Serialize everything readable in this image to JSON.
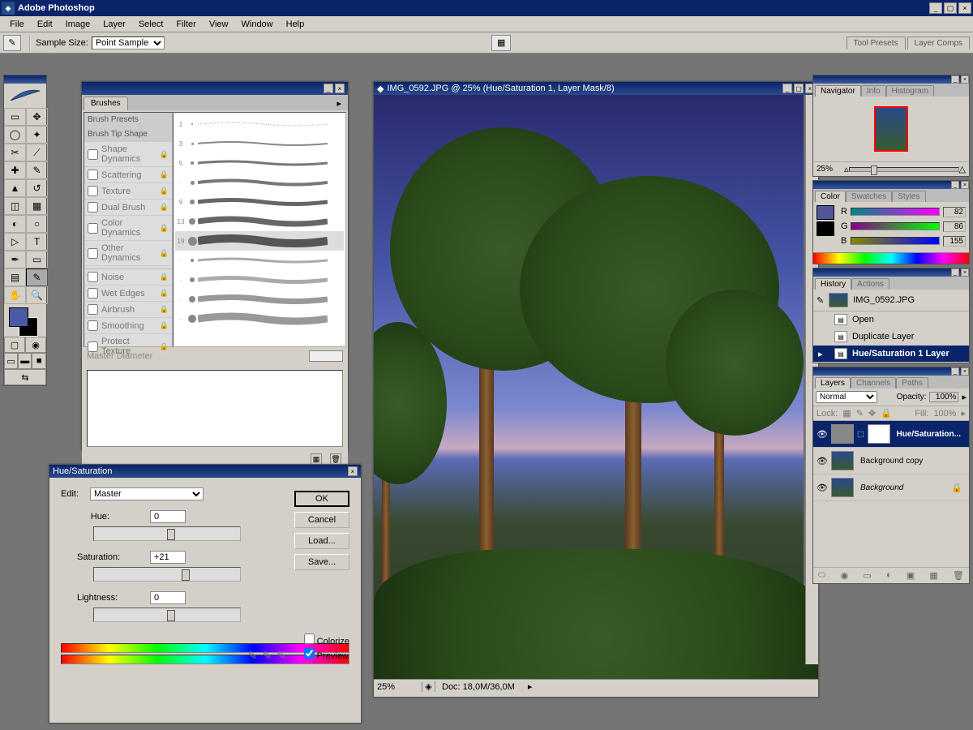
{
  "app": {
    "title": "Adobe Photoshop"
  },
  "menu": [
    "File",
    "Edit",
    "Image",
    "Layer",
    "Select",
    "Filter",
    "View",
    "Window",
    "Help"
  ],
  "options": {
    "sampleLabel": "Sample Size:",
    "sampleValue": "Point Sample",
    "dockTabs": [
      "Tool Presets",
      "Layer Comps"
    ]
  },
  "brushes": {
    "title": "Brushes",
    "categories": [
      "Brush Presets",
      "Brush Tip Shape",
      "Shape Dynamics",
      "Scattering",
      "Texture",
      "Dual Brush",
      "Color Dynamics",
      "Other Dynamics"
    ],
    "extras": [
      "Noise",
      "Wet Edges",
      "Airbrush",
      "Smoothing",
      "Protect Texture"
    ],
    "sizes": [
      1,
      3,
      5,
      "·",
      "·",
      "9",
      "13",
      "19",
      "·",
      "·",
      "·",
      "·"
    ],
    "master": "Master Diameter"
  },
  "doc": {
    "title": "IMG_0592.JPG @ 25% (Hue/Saturation 1, Layer Mask/8)",
    "zoom": "25%",
    "info": "Doc: 18,0M/36,0M"
  },
  "hueSat": {
    "title": "Hue/Saturation",
    "editLabel": "Edit:",
    "editValue": "Master",
    "hueLabel": "Hue:",
    "hueValue": "0",
    "satLabel": "Saturation:",
    "satValue": "+21",
    "lightLabel": "Lightness:",
    "lightValue": "0",
    "ok": "OK",
    "cancel": "Cancel",
    "load": "Load...",
    "save": "Save...",
    "colorize": "Colorize",
    "preview": "Preview"
  },
  "navigator": {
    "tabs": [
      "Navigator",
      "Info",
      "Histogram"
    ],
    "zoom": "25%"
  },
  "color": {
    "tabs": [
      "Color",
      "Swatches",
      "Styles"
    ],
    "r": "82",
    "g": "86",
    "b": "155"
  },
  "history": {
    "tabs": [
      "History",
      "Actions"
    ],
    "doc": "IMG_0592.JPG",
    "items": [
      "Open",
      "Duplicate Layer",
      "Hue/Saturation 1 Layer"
    ]
  },
  "layers": {
    "tabs": [
      "Layers",
      "Channels",
      "Paths"
    ],
    "blend": "Normal",
    "opacityLabel": "Opacity:",
    "opacity": "100%",
    "lockLabel": "Lock:",
    "fillLabel": "Fill:",
    "fill": "100%",
    "items": [
      {
        "name": "Hue/Saturation...",
        "active": true,
        "mask": true
      },
      {
        "name": "Background copy"
      },
      {
        "name": "Background",
        "locked": true,
        "bg": true
      }
    ]
  }
}
